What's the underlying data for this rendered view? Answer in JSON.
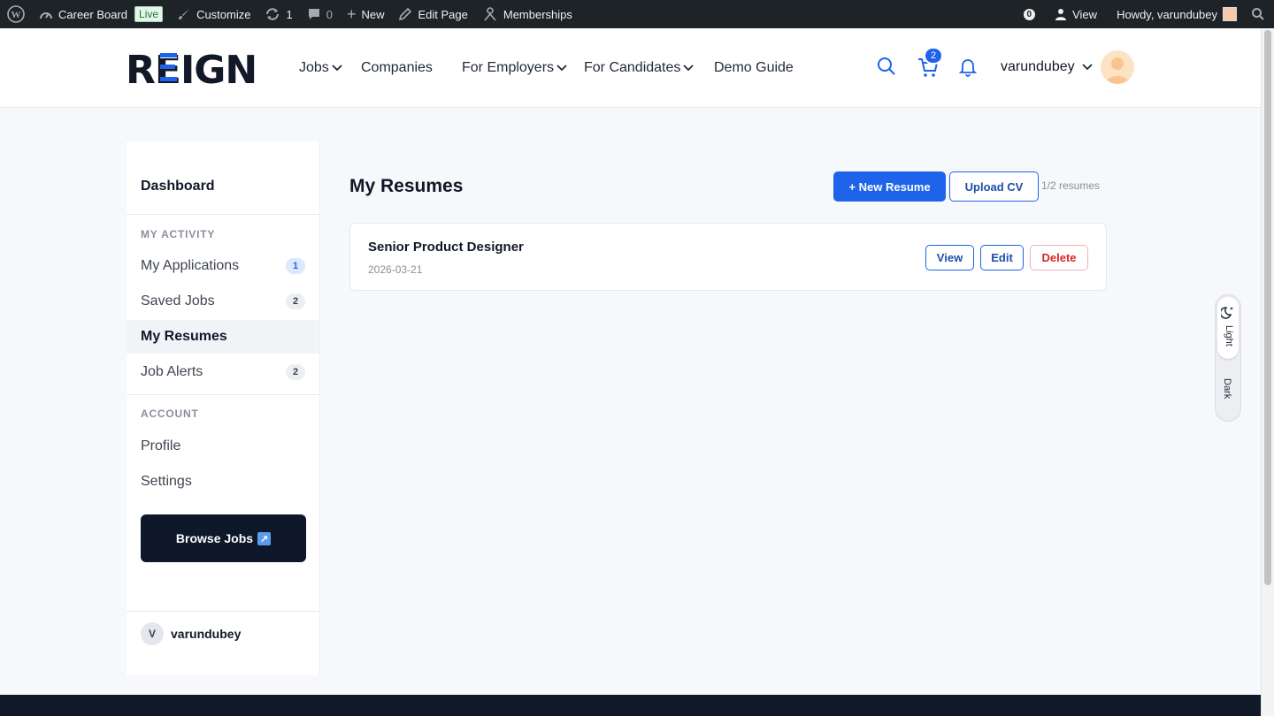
{
  "admin_bar": {
    "site_name": "Career Board",
    "live_badge": "Live",
    "customize": "Customize",
    "updates_count": "1",
    "comments_count": "0",
    "new": "New",
    "edit_page": "Edit Page",
    "memberships": "Memberships",
    "notif_count": "0",
    "view": "View",
    "howdy": "Howdy, varundubey"
  },
  "header": {
    "logo_text": "REIGN",
    "nav": [
      "Jobs",
      "Companies",
      "For Employers",
      "For Candidates",
      "Demo Guide"
    ],
    "cart_count": "2",
    "user_name": "varundubey"
  },
  "sidebar": {
    "title": "Dashboard",
    "section_activity": "MY ACTIVITY",
    "items": [
      {
        "label": "My Applications",
        "badge": "1"
      },
      {
        "label": "Saved Jobs",
        "badge": "2"
      },
      {
        "label": "My Resumes"
      },
      {
        "label": "Job Alerts",
        "badge": "2"
      }
    ],
    "section_account": "ACCOUNT",
    "account_items": [
      {
        "label": "Profile"
      },
      {
        "label": "Settings"
      }
    ],
    "browse_jobs": "Browse Jobs",
    "user_initial": "V",
    "user_name": "varundubey"
  },
  "main": {
    "title": "My Resumes",
    "new_resume": "+ New Resume",
    "upload_cv": "Upload CV",
    "resume_count": "1/2 resumes",
    "resumes": [
      {
        "title": "Senior Product Designer",
        "date": "2026-03-21",
        "view": "View",
        "edit": "Edit",
        "delete": "Delete"
      }
    ]
  },
  "theme_toggle": {
    "light": "Light",
    "dark": "Dark"
  },
  "colors": {
    "accent": "#1e63e9",
    "danger": "#dc2626",
    "dark": "#0f172a"
  }
}
